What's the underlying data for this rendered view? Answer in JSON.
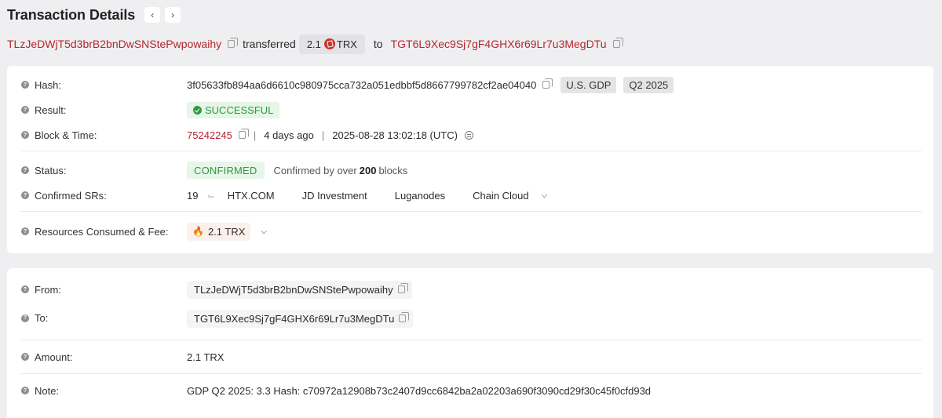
{
  "header": {
    "title": "Transaction Details",
    "prev_icon": "chevron-left-icon",
    "next_icon": "chevron-right-icon"
  },
  "summary": {
    "from": "TLzJeDWjT5d3brB2bnDwSNStePwpowaihy",
    "verb": "transferred",
    "amount": "2.1",
    "token": "TRX",
    "preposition": "to",
    "to": "TGT6L9Xec9Sj7gF4GHX6r69Lr7u3MegDTu"
  },
  "details": {
    "hash_label": "Hash:",
    "hash": "3f05633fb894aa6d6610c980975cca732a051edbbf5d8667799782cf2ae04040",
    "tags": [
      "U.S. GDP",
      "Q2 2025"
    ],
    "result_label": "Result:",
    "result": "SUCCESSFUL",
    "block_label": "Block & Time:",
    "block": "75242245",
    "age": "4 days ago",
    "timestamp": "2025-08-28 13:02:18 (UTC)",
    "status_label": "Status:",
    "status": "CONFIRMED",
    "confirmed_text": "Confirmed by over",
    "confirmed_count": "200",
    "confirmed_unit": "blocks",
    "srs_label": "Confirmed SRs:",
    "srs_count": "19",
    "srs": [
      "HTX.COM",
      "JD Investment",
      "Luganodes",
      "Chain Cloud"
    ],
    "resources_label": "Resources Consumed & Fee:",
    "fee": "2.1 TRX"
  },
  "transfer": {
    "from_label": "From:",
    "from": "TLzJeDWjT5d3brB2bnDwSNStePwpowaihy",
    "to_label": "To:",
    "to": "TGT6L9Xec9Sj7gF4GHX6r69Lr7u3MegDTu",
    "amount_label": "Amount:",
    "amount": "2.1 TRX",
    "note_label": "Note:",
    "note": "GDP Q2 2025: 3.3 Hash: c70972a12908b73c2407d9cc6842ba2a02203a690f3090cd29f30c45f0cfd93d"
  },
  "colors": {
    "link": "#b5262c",
    "success": "#2e9a3e",
    "background": "#efeff1"
  }
}
